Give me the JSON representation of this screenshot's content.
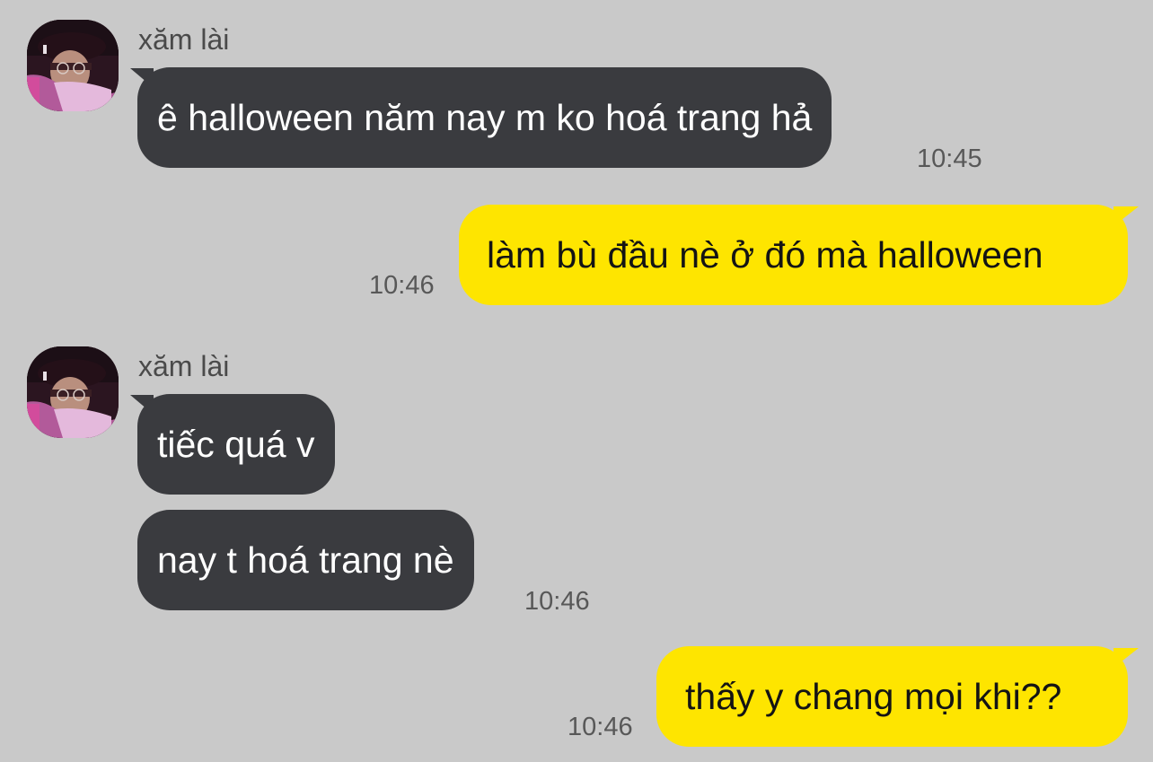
{
  "chat": {
    "messages": [
      {
        "sender": "xăm lài",
        "avatar_icon": "user-avatar-photo",
        "text": "ê halloween năm nay m ko hoá trang hả",
        "time": "10:45",
        "side": "incoming"
      },
      {
        "text": "làm bù đầu nè ở đó mà halloween",
        "time": "10:46",
        "side": "outgoing"
      },
      {
        "sender": "xăm lài",
        "avatar_icon": "user-avatar-photo",
        "text": "tiếc quá v",
        "side": "incoming"
      },
      {
        "text": "nay t hoá trang nè",
        "time": "10:46",
        "side": "incoming"
      },
      {
        "text": "thấy y chang mọi khi??",
        "time": "10:46",
        "side": "outgoing"
      }
    ]
  },
  "colors": {
    "background": "#c9c9c9",
    "incoming_bubble": "#3a3b3f",
    "outgoing_bubble": "#fee500"
  }
}
